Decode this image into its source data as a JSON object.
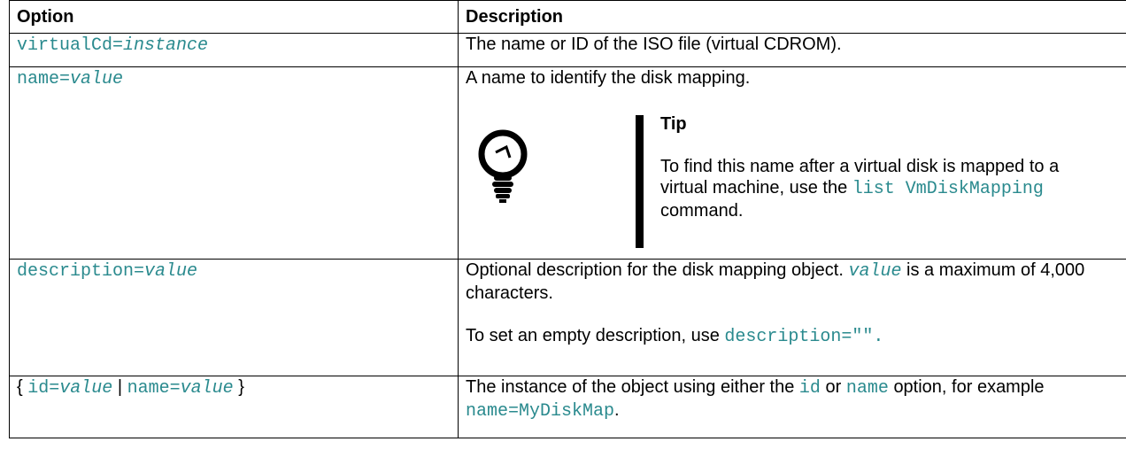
{
  "table": {
    "headers": [
      "Option",
      "Description"
    ],
    "rows": [
      {
        "option_prefix": "virtualCd=",
        "option_italic": "instance",
        "description": "The name or ID of the ISO file (virtual CDROM)."
      },
      {
        "option_prefix": "name=",
        "option_italic": "value",
        "description": "A name to identify the disk mapping.",
        "tip": {
          "title": "Tip",
          "text_before": "To find this name after a virtual disk is mapped to a virtual machine, use the",
          "code": "list VmDiskMapping",
          "text_after": "command."
        }
      },
      {
        "option_prefix": "description=",
        "option_italic": "value",
        "desc_code": "value",
        "desc_text1": "Optional description for the disk mapping object.",
        "desc_text2": "is a maximum of 4,000 characters.",
        "desc_para2": "To set an empty description, use",
        "desc_para2_code": "description=\"\"."
      },
      {
        "open_brace": "{",
        "id_prefix": "id=",
        "id_italic": "value",
        "separator": "|",
        "name_prefix": "name=",
        "name_italic": "value",
        "close_brace": "}",
        "desc_text1": "The instance of the object using either the",
        "desc_code1": "id",
        "desc_text2": "or",
        "desc_code2": "name",
        "desc_text3": "option, for example",
        "desc_code3": "name=MyDiskMap",
        "desc_text4": "."
      }
    ]
  },
  "icons": {
    "tip": "lightbulb-icon"
  }
}
